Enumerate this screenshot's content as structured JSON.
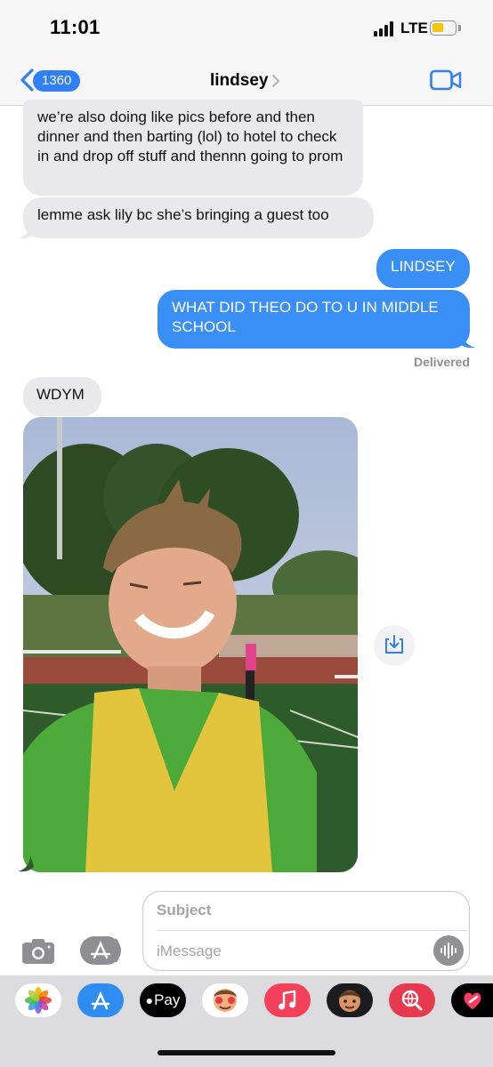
{
  "status_bar": {
    "time": "11:01",
    "network": "LTE"
  },
  "nav": {
    "back_count": "1360",
    "contact_name": "lindsey",
    "back_icon": "chevron-left-icon",
    "video_icon": "video-camera-icon"
  },
  "messages": [
    {
      "from": "them",
      "text": "we’re also doing like pics before and then dinner and then barting (lol) to hotel to check in and drop off stuff and thennn going to prom"
    },
    {
      "from": "them",
      "text": "lemme ask lily bc she’s bringing a guest too"
    },
    {
      "from": "me",
      "text": "LINDSEY"
    },
    {
      "from": "me",
      "text": "WHAT DID THEO DO TO U IN MIDDLE SCHOOL"
    },
    {
      "from": "them",
      "text": "WDYM"
    }
  ],
  "delivered_label": "Delivered",
  "composer": {
    "subject_placeholder": "Subject",
    "message_placeholder": "iMessage"
  },
  "app_drawer": {
    "apple_pay_label": "Pay",
    "apps": [
      "photos-icon",
      "app-store-icon",
      "apple-pay-icon",
      "memoji-stickers-icon",
      "music-icon",
      "animoji-icon",
      "web-images-icon",
      "digital-touch-icon"
    ]
  },
  "colors": {
    "accent_blue": "#3a8ff7",
    "incoming_bubble": "#e9e9eb",
    "battery": "#f5c60b"
  }
}
